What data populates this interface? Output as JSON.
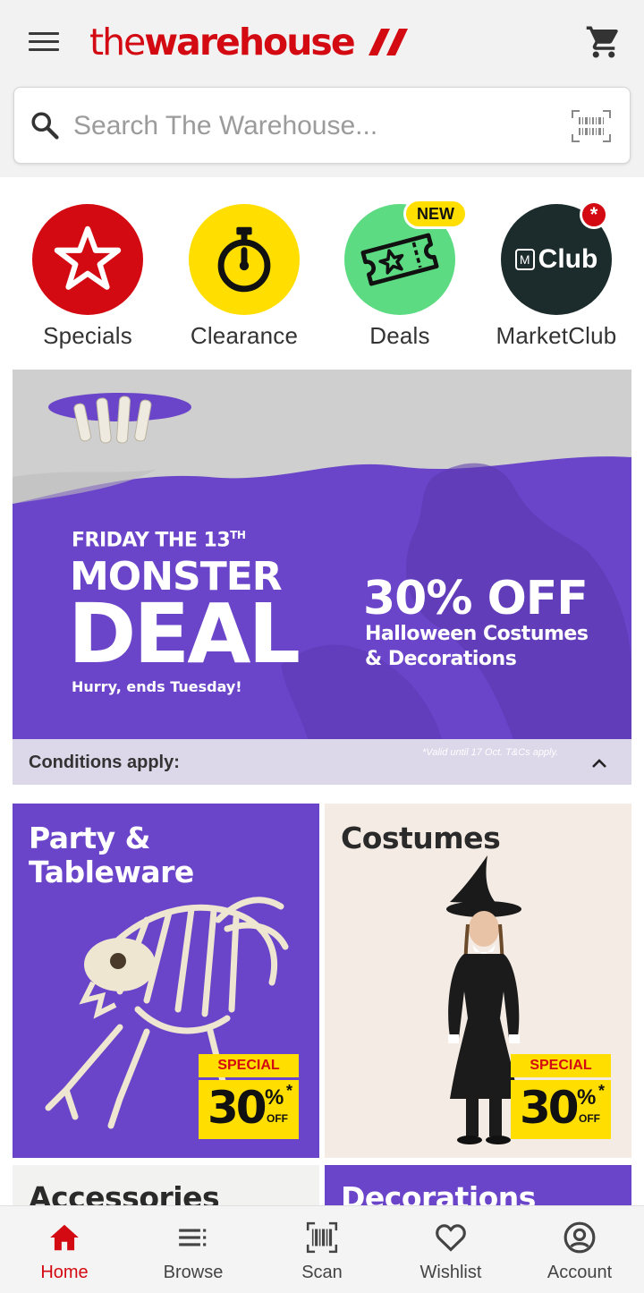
{
  "header": {
    "logo_the": "the",
    "logo_brand": "warehouse",
    "brand_color": "#d30a12"
  },
  "search": {
    "placeholder": "Search The Warehouse..."
  },
  "quick_links": [
    {
      "label": "Specials",
      "icon": "star-icon",
      "color": "#d30a12"
    },
    {
      "label": "Clearance",
      "icon": "stopwatch-icon",
      "color": "#ffde00"
    },
    {
      "label": "Deals",
      "icon": "ticket-icon",
      "color": "#5ddb82",
      "badge": "NEW"
    },
    {
      "label": "MarketClub",
      "icon": "marketclub-logo",
      "color": "#1c2b2b",
      "badge": "*"
    }
  ],
  "marketclub_logo_text": "Club",
  "marketclub_logo_mark": "M",
  "hero": {
    "pre": "FRIDAY THE 13",
    "pre_sup": "TH",
    "title_1": "MONSTER",
    "title_2": "DEAL",
    "hurry": "Hurry, ends Tuesday!",
    "offer": "30% OFF",
    "offer_sub_1": "Halloween Costumes",
    "offer_sub_2": "& Decorations"
  },
  "conditions": {
    "label": "Conditions apply:",
    "valid": "*Valid until 17 Oct. T&Cs apply."
  },
  "tiles": [
    {
      "title_1": "Party &",
      "title_2": "Tableware",
      "special": "SPECIAL",
      "percent": "30",
      "pct_sign": "%",
      "star": "*",
      "off": "OFF"
    },
    {
      "title_1": "Costumes",
      "special": "SPECIAL",
      "percent": "30",
      "pct_sign": "%",
      "star": "*",
      "off": "OFF"
    },
    {
      "title_1": "Accessories"
    },
    {
      "title_1": "Decorations"
    }
  ],
  "bottom_nav": [
    {
      "label": "Home",
      "icon": "home-icon",
      "active": true
    },
    {
      "label": "Browse",
      "icon": "browse-icon"
    },
    {
      "label": "Scan",
      "icon": "scan-icon"
    },
    {
      "label": "Wishlist",
      "icon": "heart-icon"
    },
    {
      "label": "Account",
      "icon": "account-icon"
    }
  ]
}
